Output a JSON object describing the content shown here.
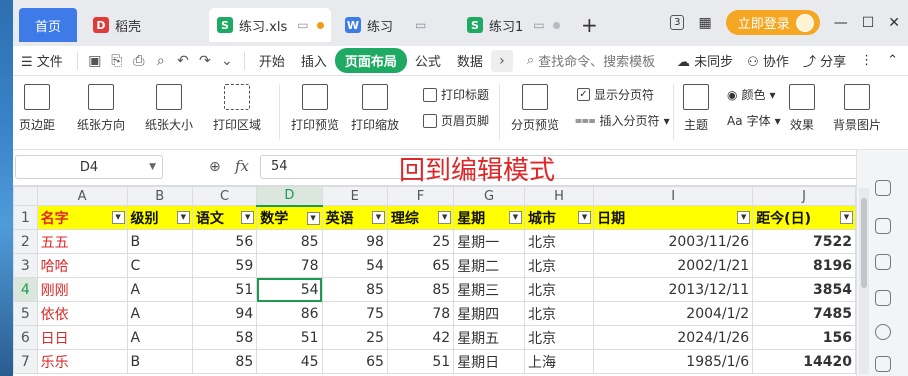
{
  "tabs": {
    "home": "首页",
    "items": [
      {
        "label": "稻壳",
        "icon_color": "#e03b3b",
        "icon_char": "D"
      },
      {
        "label": "练习.xls",
        "icon_color": "#1faa64",
        "icon_char": "S"
      },
      {
        "label": "练习",
        "icon_color": "#3b7ce8",
        "icon_char": "W"
      },
      {
        "label": "练习1",
        "icon_color": "#1faa64",
        "icon_char": "S"
      }
    ]
  },
  "window": {
    "counter": "3",
    "login": "立即登录"
  },
  "menu": {
    "file": "文件",
    "items": [
      "开始",
      "插入",
      "页面布局",
      "公式",
      "数据"
    ],
    "active": "页面布局",
    "search_placeholder": "查找命令、搜索模板",
    "unsynced": "未同步",
    "collab": "协作",
    "share": "分享"
  },
  "ribbon": {
    "margin": "页边距",
    "orientation": "纸张方向",
    "size": "纸张大小",
    "print_area": "打印区域",
    "print_preview": "打印预览",
    "print_scale": "打印缩放",
    "print_title": "打印标题",
    "header_footer": "页眉页脚",
    "page_break_preview": "分页预览",
    "show_page_break": "显示分页符",
    "insert_page_break": "插入分页符",
    "theme": "主题",
    "color": "颜色",
    "font": "字体",
    "effect": "效果",
    "background": "背景图片"
  },
  "formula": {
    "cell_ref": "D4",
    "value": "54",
    "overlay": "回到编辑模式"
  },
  "sheet": {
    "columns": [
      "A",
      "B",
      "C",
      "D",
      "E",
      "F",
      "G",
      "H",
      "I",
      "J"
    ],
    "headers": [
      "名字",
      "级别",
      "语文",
      "数学",
      "英语",
      "理综",
      "星期",
      "城市",
      "日期",
      "距今(日)"
    ],
    "rows": [
      {
        "n": "2",
        "cells": [
          "五五",
          "B",
          "56",
          "85",
          "98",
          "25",
          "星期一",
          "北京",
          "2003/11/26",
          "7522"
        ]
      },
      {
        "n": "3",
        "cells": [
          "哈哈",
          "C",
          "59",
          "78",
          "54",
          "65",
          "星期二",
          "北京",
          "2002/1/21",
          "8196"
        ]
      },
      {
        "n": "4",
        "cells": [
          "刚刚",
          "A",
          "51",
          "54",
          "85",
          "85",
          "星期三",
          "北京",
          "2013/12/11",
          "3854"
        ]
      },
      {
        "n": "5",
        "cells": [
          "依依",
          "A",
          "94",
          "86",
          "75",
          "78",
          "星期四",
          "北京",
          "2004/1/2",
          "7485"
        ]
      },
      {
        "n": "6",
        "cells": [
          "日日",
          "A",
          "58",
          "51",
          "25",
          "42",
          "星期五",
          "北京",
          "2024/1/26",
          "156"
        ]
      },
      {
        "n": "7",
        "cells": [
          "乐乐",
          "B",
          "85",
          "45",
          "65",
          "51",
          "星期日",
          "上海",
          "1985/1/6",
          "14420"
        ]
      }
    ]
  }
}
